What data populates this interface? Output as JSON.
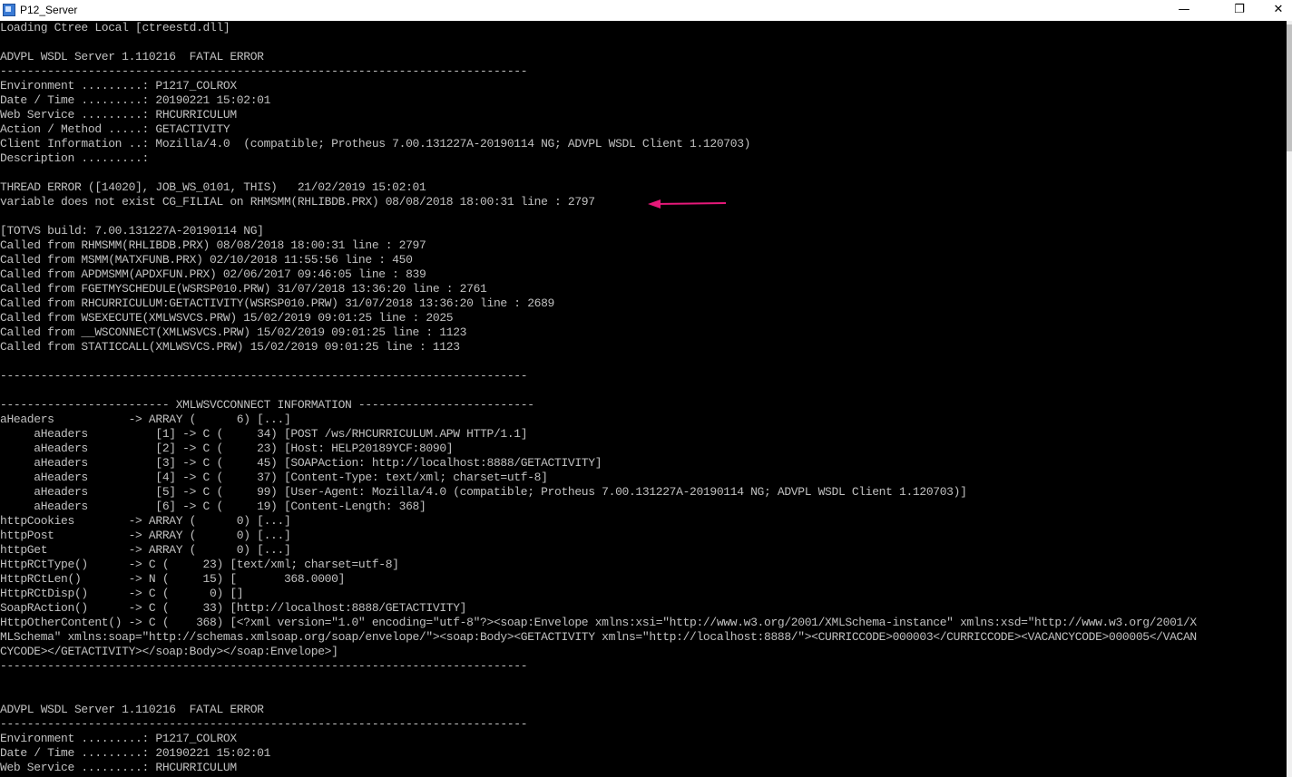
{
  "window": {
    "title": "P12_Server",
    "minimize_glyph": "—",
    "maximize_glyph": "❐",
    "close_glyph": "✕"
  },
  "colors": {
    "background": "#000000",
    "text": "#c0c0c0",
    "annotation_arrow": "#e6197a"
  },
  "console": {
    "lines": [
      "Loading Ctree Local [ctreestd.dll]",
      "",
      "ADVPL WSDL Server 1.110216  FATAL ERROR",
      "------------------------------------------------------------------------------",
      "Environment .........: P1217_COLROX",
      "Date / Time .........: 20190221 15:02:01",
      "Web Service .........: RHCURRICULUM",
      "Action / Method .....: GETACTIVITY",
      "Client Information ..: Mozilla/4.0  (compatible; Protheus 7.00.131227A-20190114 NG; ADVPL WSDL Client 1.120703)",
      "Description .........:",
      "",
      "THREAD ERROR ([14020], JOB_WS_0101, THIS)   21/02/2019 15:02:01",
      "variable does not exist CG_FILIAL on RHMSMM(RHLIBDB.PRX) 08/08/2018 18:00:31 line : 2797",
      "",
      "[TOTVS build: 7.00.131227A-20190114 NG]",
      "Called from RHMSMM(RHLIBDB.PRX) 08/08/2018 18:00:31 line : 2797",
      "Called from MSMM(MATXFUNB.PRX) 02/10/2018 11:55:56 line : 450",
      "Called from APDMSMM(APDXFUN.PRX) 02/06/2017 09:46:05 line : 839",
      "Called from FGETMYSCHEDULE(WSRSP010.PRW) 31/07/2018 13:36:20 line : 2761",
      "Called from RHCURRICULUM:GETACTIVITY(WSRSP010.PRW) 31/07/2018 13:36:20 line : 2689",
      "Called from WSEXECUTE(XMLWSVCS.PRW) 15/02/2019 09:01:25 line : 2025",
      "Called from __WSCONNECT(XMLWSVCS.PRW) 15/02/2019 09:01:25 line : 1123",
      "Called from STATICCALL(XMLWSVCS.PRW) 15/02/2019 09:01:25 line : 1123",
      "",
      "------------------------------------------------------------------------------",
      "",
      "------------------------- XMLWSVCCONNECT INFORMATION --------------------------",
      "aHeaders           -> ARRAY (      6) [...]",
      "     aHeaders          [1] -> C (     34) [POST /ws/RHCURRICULUM.APW HTTP/1.1]",
      "     aHeaders          [2] -> C (     23) [Host: HELP20189YCF:8090]",
      "     aHeaders          [3] -> C (     45) [SOAPAction: http://localhost:8888/GETACTIVITY]",
      "     aHeaders          [4] -> C (     37) [Content-Type: text/xml; charset=utf-8]",
      "     aHeaders          [5] -> C (     99) [User-Agent: Mozilla/4.0 (compatible; Protheus 7.00.131227A-20190114 NG; ADVPL WSDL Client 1.120703)]",
      "     aHeaders          [6] -> C (     19) [Content-Length: 368]",
      "httpCookies        -> ARRAY (      0) [...]",
      "httpPost           -> ARRAY (      0) [...]",
      "httpGet            -> ARRAY (      0) [...]",
      "HttpRCtType()      -> C (     23) [text/xml; charset=utf-8]",
      "HttpRCtLen()       -> N (     15) [       368.0000]",
      "HttpRCtDisp()      -> C (      0) []",
      "SoapRAction()      -> C (     33) [http://localhost:8888/GETACTIVITY]",
      "HttpOtherContent() -> C (    368) [<?xml version=\"1.0\" encoding=\"utf-8\"?><soap:Envelope xmlns:xsi=\"http://www.w3.org/2001/XMLSchema-instance\" xmlns:xsd=\"http://www.w3.org/2001/X",
      "MLSchema\" xmlns:soap=\"http://schemas.xmlsoap.org/soap/envelope/\"><soap:Body><GETACTIVITY xmlns=\"http://localhost:8888/\"><CURRICCODE>000003</CURRICCODE><VACANCYCODE>000005</VACAN",
      "CYCODE></GETACTIVITY></soap:Body></soap:Envelope>]",
      "------------------------------------------------------------------------------",
      "",
      "",
      "ADVPL WSDL Server 1.110216  FATAL ERROR",
      "------------------------------------------------------------------------------",
      "Environment .........: P1217_COLROX",
      "Date / Time .........: 20190221 15:02:01",
      "Web Service .........: RHCURRICULUM"
    ]
  }
}
